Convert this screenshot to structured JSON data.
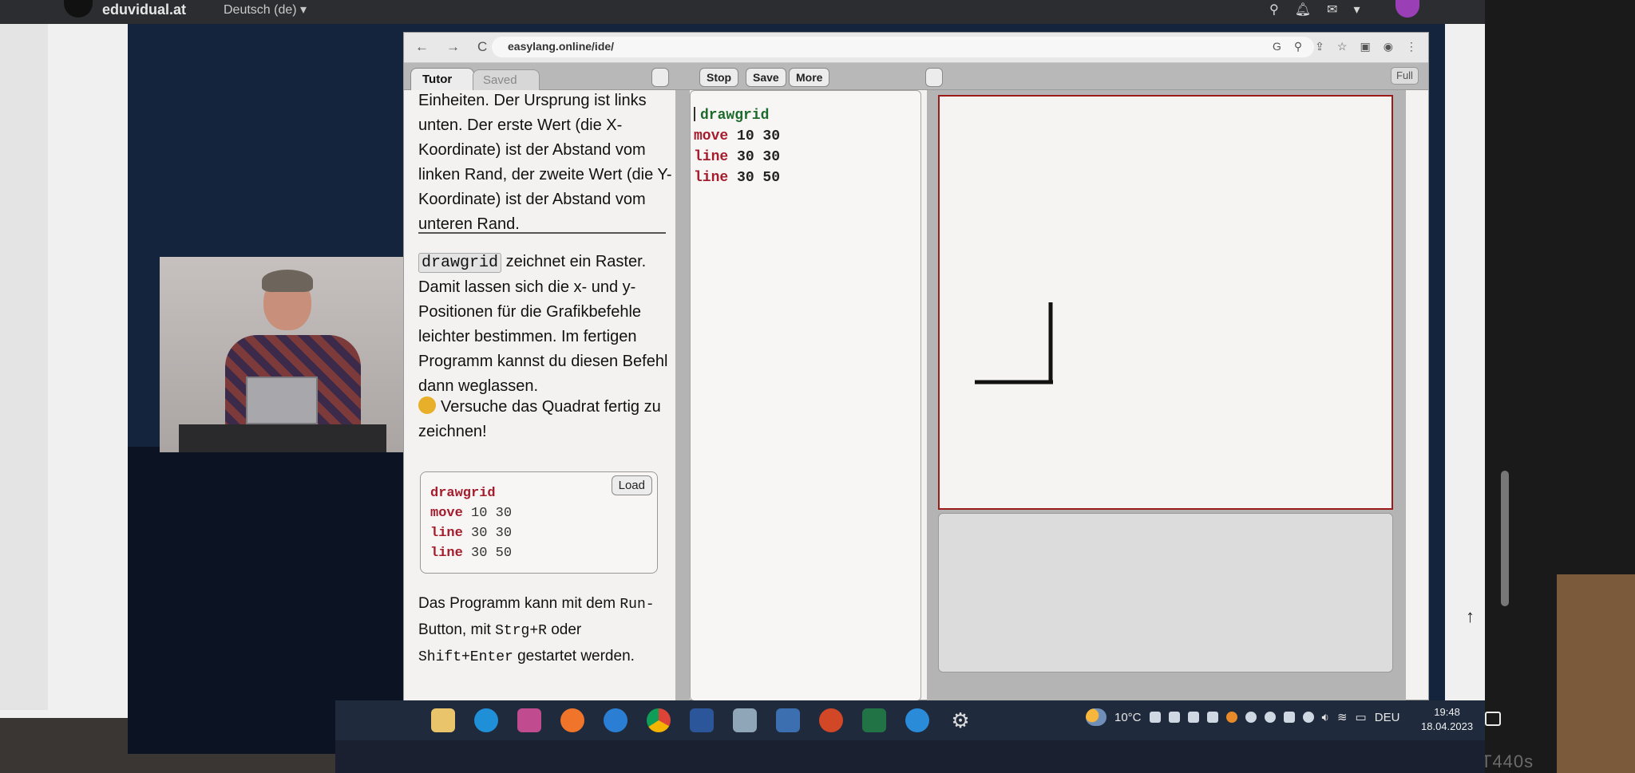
{
  "outer_browser": {
    "site_name": "eduvidual.at",
    "language": "Deutsch (de) ▾"
  },
  "inner_browser": {
    "url": "easylang.online/ide/"
  },
  "toolbar": {
    "tutor_tab": "Tutor",
    "saved_tab": "Saved",
    "stop_label": "Stop",
    "save_label": "Save",
    "more_label": "More",
    "full_label": "Full"
  },
  "tutor": {
    "para1": "Einheiten. Der Ursprung ist links unten. Der erste Wert (die X-Koordinate) ist der Abstand vom linken Rand, der zweite Wert (die Y-Koordinate) ist der Abstand vom unteren Rand.",
    "drawgrid_kw": "drawgrid",
    "para2": " zeichnet ein Raster. Damit lassen sich die x- und y-Positionen für die Grafikbefehle leichter bestimmen. Im fertigen Programm kannst du diesen Befehl dann weglassen.",
    "task": "Versuche das Quadrat fertig zu zeichnen!",
    "example_code": [
      {
        "cmd": "drawgrid",
        "args": ""
      },
      {
        "cmd": "move",
        "args": "10 30"
      },
      {
        "cmd": "line",
        "args": "30 30"
      },
      {
        "cmd": "line",
        "args": "30 50"
      }
    ],
    "load_label": "Load",
    "run_text_a": "Das Programm kann mit dem ",
    "run_kbd": "Run-",
    "run_text_b": "Button, mit ",
    "kbd_ctrl_r": "Strg+R",
    "run_text_c": " oder",
    "kbd_shift_enter": "Shift+Enter",
    "run_text_d": " gestartet werden."
  },
  "editor": {
    "lines": [
      {
        "cmd": "drawgrid",
        "args": ""
      },
      {
        "cmd": "move",
        "args": "10 30"
      },
      {
        "cmd": "line",
        "args": "30 30"
      },
      {
        "cmd": "line",
        "args": "30 50"
      }
    ]
  },
  "taskbar": {
    "weather": "10°C",
    "lang": "DEU",
    "time": "19:48",
    "date": "18.04.2023"
  },
  "device_label": "T440s",
  "colors": {
    "canvas_border": "#9b1b1b",
    "keyword_red": "#a51d2d",
    "keyword_green": "#1c6b2c"
  }
}
